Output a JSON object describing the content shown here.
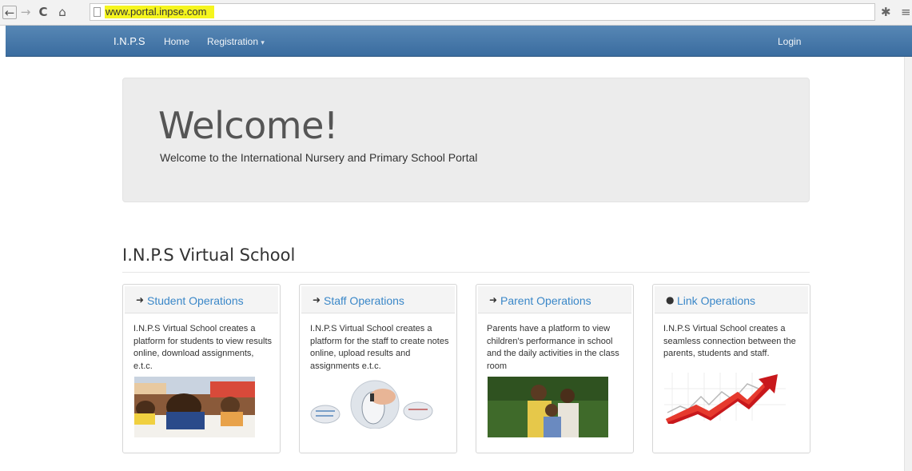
{
  "browser": {
    "back_icon": "back-arrow-icon",
    "forward_icon": "forward-arrow-icon",
    "reload_icon": "reload-icon",
    "home_icon": "home-icon",
    "url": "www.portal.inpse.com",
    "url_highlight": "#f5f51e"
  },
  "navbar": {
    "brand": "I.N.P.S",
    "home": "Home",
    "registration": "Registration",
    "login": "Login",
    "color": "#4a7aab"
  },
  "jumbotron": {
    "title": "Welcome!",
    "subtitle": "Welcome to the International Nursery and Primary School Portal"
  },
  "section": {
    "title": "I.N.P.S Virtual School"
  },
  "cards": [
    {
      "icon": "login-icon",
      "title": "Student Operations",
      "text": "I.N.P.S Virtual School creates a platform for students to view results online, download assignments, e.t.c.",
      "image": "student-writing-photo"
    },
    {
      "icon": "login-icon",
      "title": "Staff Operations",
      "text": "I.N.P.S Virtual School creates a platform for the staff to create notes online, upload results and assignments e.t.c.",
      "image": "mouse-on-documents-photo"
    },
    {
      "icon": "login-icon",
      "title": "Parent Operations",
      "text": "Parents have a platform to view children's performance in school and the daily activities in the class room",
      "image": "family-photo"
    },
    {
      "icon": "globe-icon",
      "title": "Link Operations",
      "text": "I.N.P.S Virtual School creates a seamless connection between the parents, students and staff.",
      "image": "growth-arrow-chart-image"
    }
  ]
}
